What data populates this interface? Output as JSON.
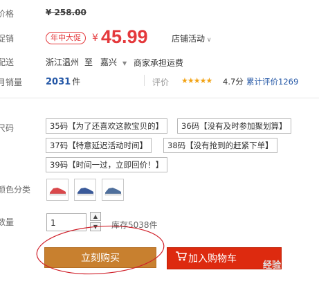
{
  "price_row": {
    "label": "价格",
    "original_price": "¥ 258.00"
  },
  "promo_row": {
    "label": "促销",
    "badge": "年中大促",
    "currency": "¥",
    "price": "45.99",
    "shop_event": "店铺活动"
  },
  "shipping_row": {
    "label": "配送",
    "from": "浙江温州",
    "to_word": "至",
    "destination": "嘉兴",
    "note": "商家承担运费"
  },
  "sales_row": {
    "label": "月销量",
    "count": "2031",
    "unit": "件",
    "rating_label": "评价",
    "stars": "★★★★★",
    "score": "4.7分",
    "reviews": "累计评价1269"
  },
  "size_row": {
    "label": "尺码",
    "options": [
      "35码【为了还喜欢这款宝贝的】",
      "36码【没有及时参加聚划算】",
      "37码【特意延迟活动时间】",
      "38码【没有抢到的赶紧下单】",
      "39码【时间一过，立即回价！】"
    ]
  },
  "color_row": {
    "label": "颜色分类",
    "swatch_colors": [
      "#d9484b",
      "#3a5a9a",
      "#4f6f9c"
    ]
  },
  "qty_row": {
    "label": "数量",
    "value": "1",
    "stock": "库存5038件"
  },
  "actions": {
    "buy_label": "立刻购买",
    "cart_label": "加入购物车",
    "highlight_color": "#d0202a"
  },
  "watermark": {
    "text": "经验"
  }
}
